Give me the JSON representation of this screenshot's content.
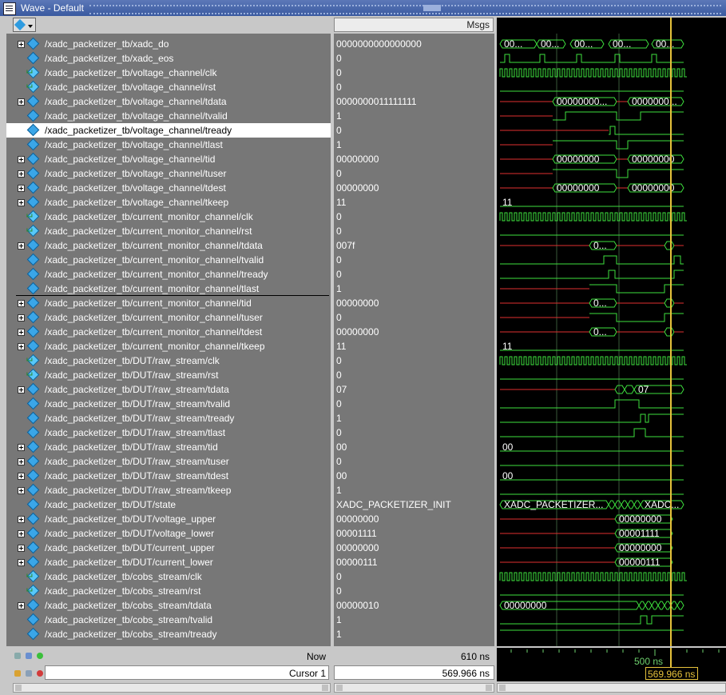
{
  "window": {
    "title": "Wave - Default"
  },
  "values_header": "Msgs",
  "colors": {
    "green": "#3ee03e",
    "red": "#e03030",
    "cursor": "#e6c23b",
    "grid": "#3a5a3a"
  },
  "signals": [
    {
      "name": "/xadc_packetizer_tb/xadc_do",
      "value": "0000000000000000",
      "expand": true,
      "icon": "signal-icon",
      "wave": "bus",
      "labels": [
        "00...",
        "00...",
        "00...",
        "00...",
        "00..."
      ]
    },
    {
      "name": "/xadc_packetizer_tb/xadc_eos",
      "value": "0",
      "expand": false,
      "icon": "signal-icon",
      "wave": "pulse5"
    },
    {
      "name": "/xadc_packetizer_tb/voltage_channel/clk",
      "value": "0",
      "expand": false,
      "icon": "clock-icon",
      "wave": "clk"
    },
    {
      "name": "/xadc_packetizer_tb/voltage_channel/rst",
      "value": "0",
      "expand": false,
      "icon": "clock-icon",
      "wave": "low"
    },
    {
      "name": "/xadc_packetizer_tb/voltage_channel/tdata",
      "value": "0000000011111111",
      "expand": true,
      "icon": "signal-icon",
      "wave": "bus2",
      "labels": [
        "00000000...",
        "0000000..."
      ]
    },
    {
      "name": "/xadc_packetizer_tb/voltage_channel/tvalid",
      "value": "1",
      "expand": false,
      "icon": "signal-icon",
      "wave": "valid"
    },
    {
      "name": "/xadc_packetizer_tb/voltage_channel/tready",
      "value": "0",
      "expand": false,
      "icon": "signal-icon",
      "wave": "ready",
      "selected": true
    },
    {
      "name": "/xadc_packetizer_tb/voltage_channel/tlast",
      "value": "1",
      "expand": false,
      "icon": "signal-icon",
      "wave": "last"
    },
    {
      "name": "/xadc_packetizer_tb/voltage_channel/tid",
      "value": "00000000",
      "expand": true,
      "icon": "signal-icon",
      "wave": "bus2",
      "labels": [
        "00000000",
        "00000000"
      ]
    },
    {
      "name": "/xadc_packetizer_tb/voltage_channel/tuser",
      "value": "0",
      "expand": true,
      "icon": "signal-icon",
      "wave": "last"
    },
    {
      "name": "/xadc_packetizer_tb/voltage_channel/tdest",
      "value": "00000000",
      "expand": true,
      "icon": "signal-icon",
      "wave": "bus2",
      "labels": [
        "00000000",
        "00000000"
      ]
    },
    {
      "name": "/xadc_packetizer_tb/voltage_channel/tkeep",
      "value": "11",
      "expand": true,
      "icon": "signal-icon",
      "wave": "const",
      "labels": [
        "11"
      ]
    },
    {
      "name": "/xadc_packetizer_tb/current_monitor_channel/clk",
      "value": "0",
      "expand": false,
      "icon": "clock-icon",
      "wave": "clk"
    },
    {
      "name": "/xadc_packetizer_tb/current_monitor_channel/rst",
      "value": "0",
      "expand": false,
      "icon": "clock-icon",
      "wave": "low"
    },
    {
      "name": "/xadc_packetizer_tb/current_monitor_channel/tdata",
      "value": "007f",
      "expand": true,
      "icon": "signal-icon",
      "wave": "bus3",
      "labels": [
        "0..."
      ]
    },
    {
      "name": "/xadc_packetizer_tb/current_monitor_channel/tvalid",
      "value": "0",
      "expand": false,
      "icon": "signal-icon",
      "wave": "valid2"
    },
    {
      "name": "/xadc_packetizer_tb/current_monitor_channel/tready",
      "value": "0",
      "expand": false,
      "icon": "signal-icon",
      "wave": "ready2"
    },
    {
      "name": "/xadc_packetizer_tb/current_monitor_channel/tlast",
      "value": "1",
      "expand": false,
      "icon": "signal-icon",
      "wave": "last2"
    },
    {
      "name": "/xadc_packetizer_tb/current_monitor_channel/tid",
      "value": "00000000",
      "expand": true,
      "icon": "signal-icon",
      "wave": "bus3",
      "labels": [
        "0..."
      ]
    },
    {
      "name": "/xadc_packetizer_tb/current_monitor_channel/tuser",
      "value": "0",
      "expand": true,
      "icon": "signal-icon",
      "wave": "last2"
    },
    {
      "name": "/xadc_packetizer_tb/current_monitor_channel/tdest",
      "value": "00000000",
      "expand": true,
      "icon": "signal-icon",
      "wave": "bus3",
      "labels": [
        "0..."
      ]
    },
    {
      "name": "/xadc_packetizer_tb/current_monitor_channel/tkeep",
      "value": "11",
      "expand": true,
      "icon": "signal-icon",
      "wave": "const",
      "labels": [
        "11"
      ]
    },
    {
      "name": "/xadc_packetizer_tb/DUT/raw_stream/clk",
      "value": "0",
      "expand": false,
      "icon": "clock-icon",
      "wave": "clk"
    },
    {
      "name": "/xadc_packetizer_tb/DUT/raw_stream/rst",
      "value": "0",
      "expand": false,
      "icon": "clock-icon",
      "wave": "low"
    },
    {
      "name": "/xadc_packetizer_tb/DUT/raw_stream/tdata",
      "value": "07",
      "expand": true,
      "icon": "signal-icon",
      "wave": "bus4",
      "labels": [
        "07"
      ]
    },
    {
      "name": "/xadc_packetizer_tb/DUT/raw_stream/tvalid",
      "value": "0",
      "expand": false,
      "icon": "signal-icon",
      "wave": "valid3"
    },
    {
      "name": "/xadc_packetizer_tb/DUT/raw_stream/tready",
      "value": "1",
      "expand": false,
      "icon": "signal-icon",
      "wave": "ready3"
    },
    {
      "name": "/xadc_packetizer_tb/DUT/raw_stream/tlast",
      "value": "0",
      "expand": false,
      "icon": "signal-icon",
      "wave": "last3"
    },
    {
      "name": "/xadc_packetizer_tb/DUT/raw_stream/tid",
      "value": "00",
      "expand": true,
      "icon": "signal-icon",
      "wave": "const",
      "labels": [
        "00"
      ]
    },
    {
      "name": "/xadc_packetizer_tb/DUT/raw_stream/tuser",
      "value": "0",
      "expand": true,
      "icon": "signal-icon",
      "wave": "lowg"
    },
    {
      "name": "/xadc_packetizer_tb/DUT/raw_stream/tdest",
      "value": "00",
      "expand": true,
      "icon": "signal-icon",
      "wave": "const",
      "labels": [
        "00"
      ]
    },
    {
      "name": "/xadc_packetizer_tb/DUT/raw_stream/tkeep",
      "value": "1",
      "expand": true,
      "icon": "signal-icon",
      "wave": "lowg"
    },
    {
      "name": "/xadc_packetizer_tb/DUT/state",
      "value": "XADC_PACKETIZER_INIT",
      "expand": false,
      "icon": "signal-icon",
      "wave": "state",
      "labels": [
        "XADC_PACKETIZER...",
        "XADC..."
      ]
    },
    {
      "name": "/xadc_packetizer_tb/DUT/voltage_upper",
      "value": "00000000",
      "expand": true,
      "icon": "signal-icon",
      "wave": "bus5",
      "labels": [
        "00000000"
      ]
    },
    {
      "name": "/xadc_packetizer_tb/DUT/voltage_lower",
      "value": "00001111",
      "expand": true,
      "icon": "signal-icon",
      "wave": "bus5",
      "labels": [
        "00001111"
      ]
    },
    {
      "name": "/xadc_packetizer_tb/DUT/current_upper",
      "value": "00000000",
      "expand": true,
      "icon": "signal-icon",
      "wave": "bus5",
      "labels": [
        "00000000"
      ]
    },
    {
      "name": "/xadc_packetizer_tb/DUT/current_lower",
      "value": "00000111",
      "expand": true,
      "icon": "signal-icon",
      "wave": "bus5",
      "labels": [
        "00000111"
      ]
    },
    {
      "name": "/xadc_packetizer_tb/cobs_stream/clk",
      "value": "0",
      "expand": false,
      "icon": "clock-icon",
      "wave": "clk"
    },
    {
      "name": "/xadc_packetizer_tb/cobs_stream/rst",
      "value": "0",
      "expand": false,
      "icon": "clock-icon",
      "wave": "low"
    },
    {
      "name": "/xadc_packetizer_tb/cobs_stream/tdata",
      "value": "00000010",
      "expand": true,
      "icon": "signal-icon",
      "wave": "bus6",
      "labels": [
        "00000000"
      ]
    },
    {
      "name": "/xadc_packetizer_tb/cobs_stream/tvalid",
      "value": "1",
      "expand": false,
      "icon": "signal-icon",
      "wave": "valid4"
    },
    {
      "name": "/xadc_packetizer_tb/cobs_stream/tready",
      "value": "1",
      "expand": false,
      "icon": "signal-icon",
      "wave": "high"
    }
  ],
  "footer": {
    "now_label": "Now",
    "now_value": "610 ns",
    "cursor_label": "Cursor 1",
    "cursor_value": "569.966 ns",
    "tick_label": "500 ns",
    "cursor_time_box": "569.966 ns"
  }
}
